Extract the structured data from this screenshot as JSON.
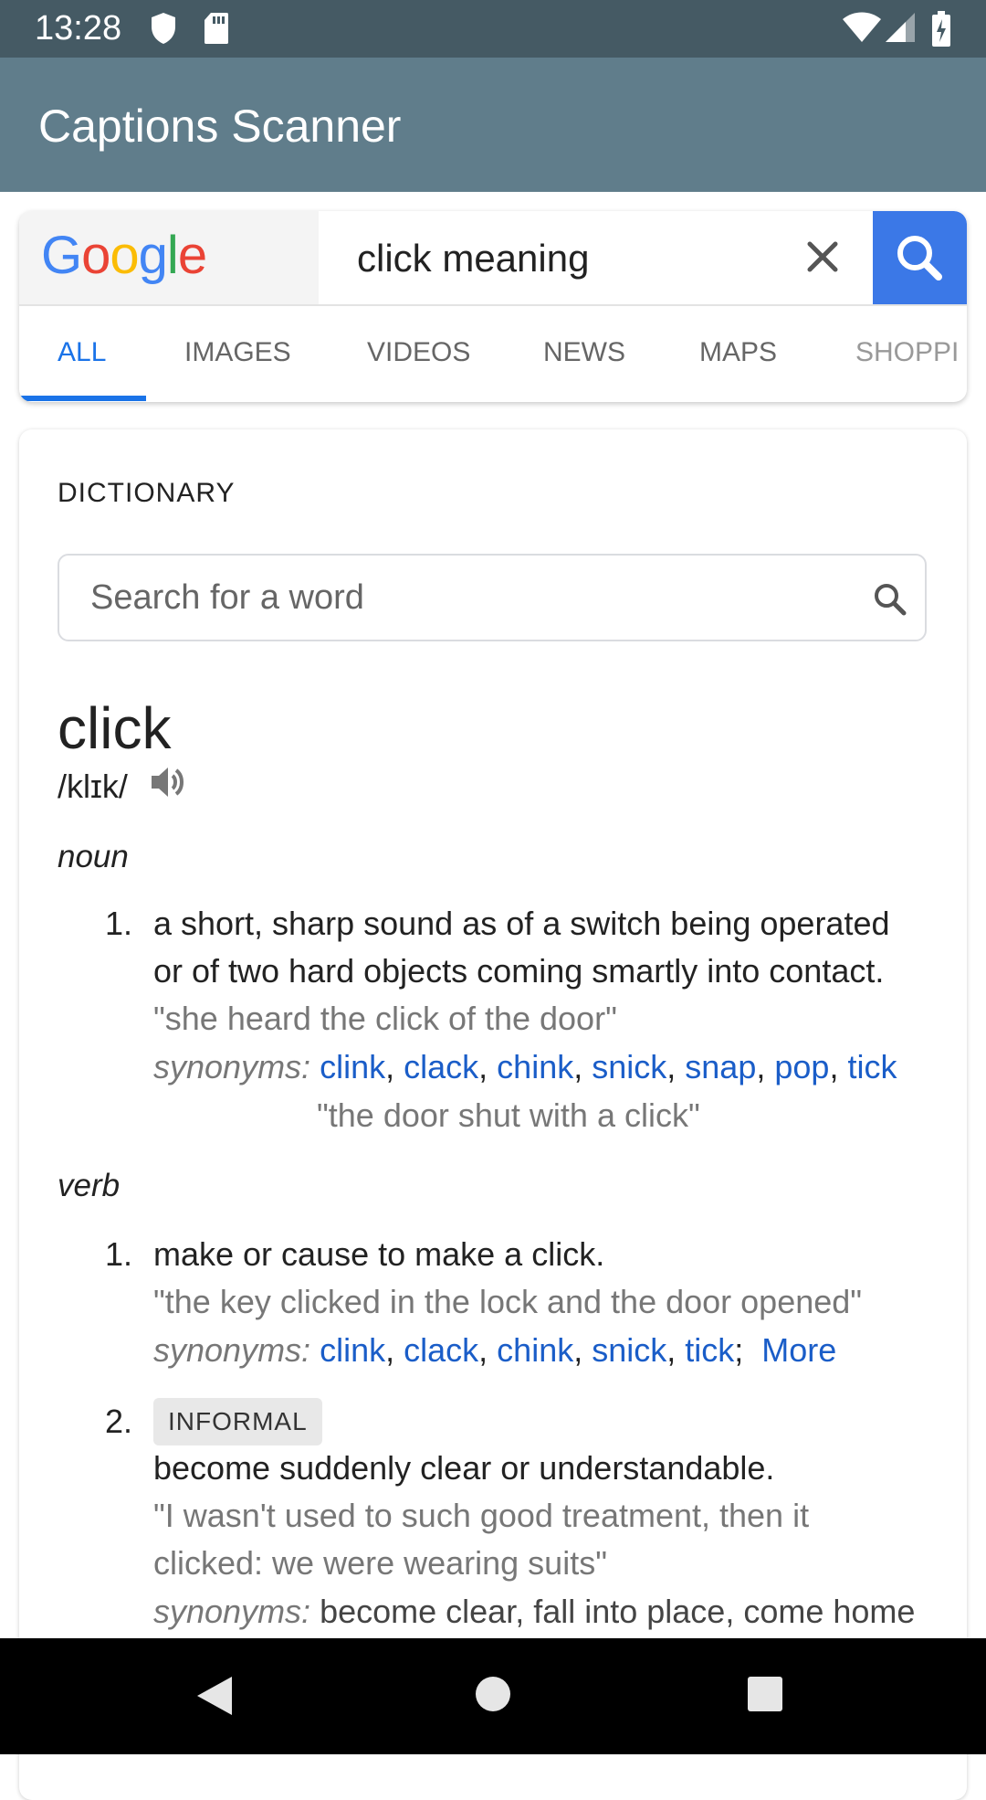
{
  "status_bar": {
    "time": "13:28",
    "icons": [
      "shield-icon",
      "sd-card-icon",
      "wifi-icon",
      "signal-icon",
      "battery-icon"
    ]
  },
  "app_bar": {
    "title": "Captions Scanner"
  },
  "search": {
    "query": "click meaning",
    "tabs": [
      "ALL",
      "IMAGES",
      "VIDEOS",
      "NEWS",
      "MAPS",
      "SHOPPI"
    ],
    "active_tab": "ALL",
    "accent": "#1a73e8",
    "button_color": "#3b78e7"
  },
  "dictionary": {
    "heading": "DICTIONARY",
    "search_placeholder": "Search for a word",
    "word": "click",
    "phonetic": "/klɪk/",
    "noun": {
      "label": "noun",
      "senses": [
        {
          "num": "1.",
          "def_1": "a short, sharp sound as of a switch being operated",
          "def_2": "or of two hard objects coming smartly into contact.",
          "example": "\"she heard the click of the door\"",
          "syn_label": "synonyms:",
          "synonyms": [
            "clink",
            "clack",
            "chink",
            "snick",
            "snap",
            "pop",
            "tick"
          ],
          "syn_example": "\"the door shut with a click\""
        }
      ]
    },
    "verb": {
      "label": "verb",
      "senses": [
        {
          "num": "1.",
          "def": "make or cause to make a click.",
          "example": "\"the key clicked in the lock and the door opened\"",
          "syn_label": "synonyms:",
          "synonyms": [
            "clink",
            "clack",
            "chink",
            "snick",
            "tick"
          ],
          "more": "More"
        },
        {
          "num": "2.",
          "badge": "INFORMAL",
          "def": "become suddenly clear or understandable.",
          "example_1": "\"I wasn't used to such good treatment, then it",
          "example_2": "clicked: we were wearing suits\"",
          "syn_label": "synonyms:",
          "syn_text": "become clear, fall into place, come home"
        }
      ]
    },
    "link_color": "#1a5dc8"
  },
  "nav_bar": {
    "icons": [
      "back-icon",
      "home-icon",
      "recents-icon"
    ]
  }
}
